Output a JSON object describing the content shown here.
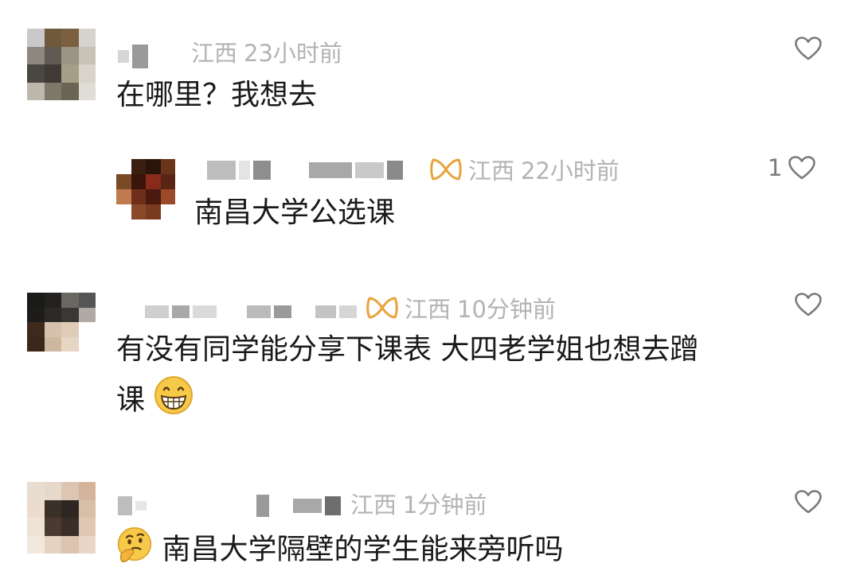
{
  "comments": [
    {
      "region": "江西",
      "time": "23小时前",
      "text": "在哪里？我想去",
      "like_icon": "heart-outline-icon"
    },
    {
      "badge_icon": "infinity-badge-icon",
      "region": "江西",
      "time": "22小时前",
      "text": "南昌大学公选课",
      "like_count": "1",
      "like_icon": "heart-outline-icon"
    },
    {
      "badge_icon": "infinity-badge-icon",
      "region": "江西",
      "time": "10分钟前",
      "text_line1": "有没有同学能分享下课表 大四老学姐也想去蹭",
      "text_line2": "课",
      "emoji": "grinning-face-emoji",
      "like_icon": "heart-outline-icon"
    },
    {
      "region": "江西",
      "time": "1分钟前",
      "emoji": "thinking-face-emoji",
      "text": "南昌大学隔壁的学生能来旁听吗",
      "like_icon": "heart-outline-icon"
    }
  ],
  "colors": {
    "text": "#1a1a1a",
    "meta": "#b3b3b3",
    "badge": "#e8a33c",
    "heart": "#7a7a7a"
  }
}
